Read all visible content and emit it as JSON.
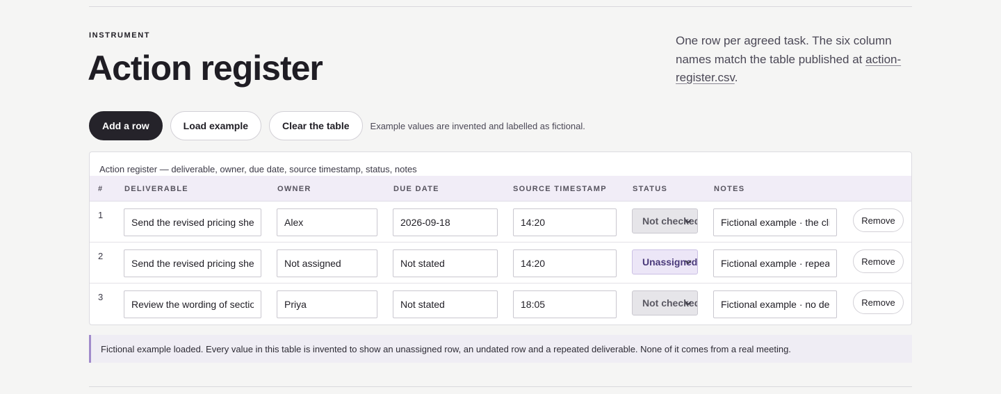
{
  "header": {
    "kicker": "INSTRUMENT",
    "title": "Action register",
    "intro_text": "One row per agreed task. The six column names match the table published at ",
    "intro_link": "action-register.csv",
    "intro_end": "."
  },
  "toolbar": {
    "add_label": "Add a row",
    "load_label": "Load example",
    "clear_label": "Clear the table",
    "note": "Example values are invented and labelled as fictional."
  },
  "table": {
    "caption": "Action register — deliverable, owner, due date, source timestamp, status, notes",
    "columns": [
      "#",
      "DELIVERABLE",
      "OWNER",
      "DUE DATE",
      "SOURCE TIMESTAMP",
      "STATUS",
      "NOTES"
    ],
    "rows": [
      {
        "num": "1",
        "deliverable": "Send the revised pricing sheet",
        "owner": "Alex",
        "due_date": "2026-09-18",
        "timestamp": "14:20",
        "status": "Not checked",
        "status_state": "neutral",
        "notes": "Fictional example · the client",
        "remove_label": "Remove"
      },
      {
        "num": "2",
        "deliverable": "Send the revised pricing sheet",
        "owner": "Not assigned",
        "due_date": "Not stated",
        "timestamp": "14:20",
        "status": "Unassigned",
        "status_state": "unassigned",
        "notes": "Fictional example · repeated",
        "remove_label": "Remove"
      },
      {
        "num": "3",
        "deliverable": "Review the wording of section",
        "owner": "Priya",
        "due_date": "Not stated",
        "timestamp": "18:05",
        "status": "Not checked",
        "status_state": "neutral",
        "notes": "Fictional example · no deadline",
        "remove_label": "Remove"
      }
    ]
  },
  "notice": "Fictional example loaded. Every value in this table is invented to show an unassigned row, an undated row and a repeated deliverable. None of it comes from a real meeting.",
  "colors": {
    "primary_button": "#25232a",
    "header_band": "#f1edf7",
    "unassigned_badge": "#ece6f7",
    "notice_accent": "#a18bcb"
  }
}
